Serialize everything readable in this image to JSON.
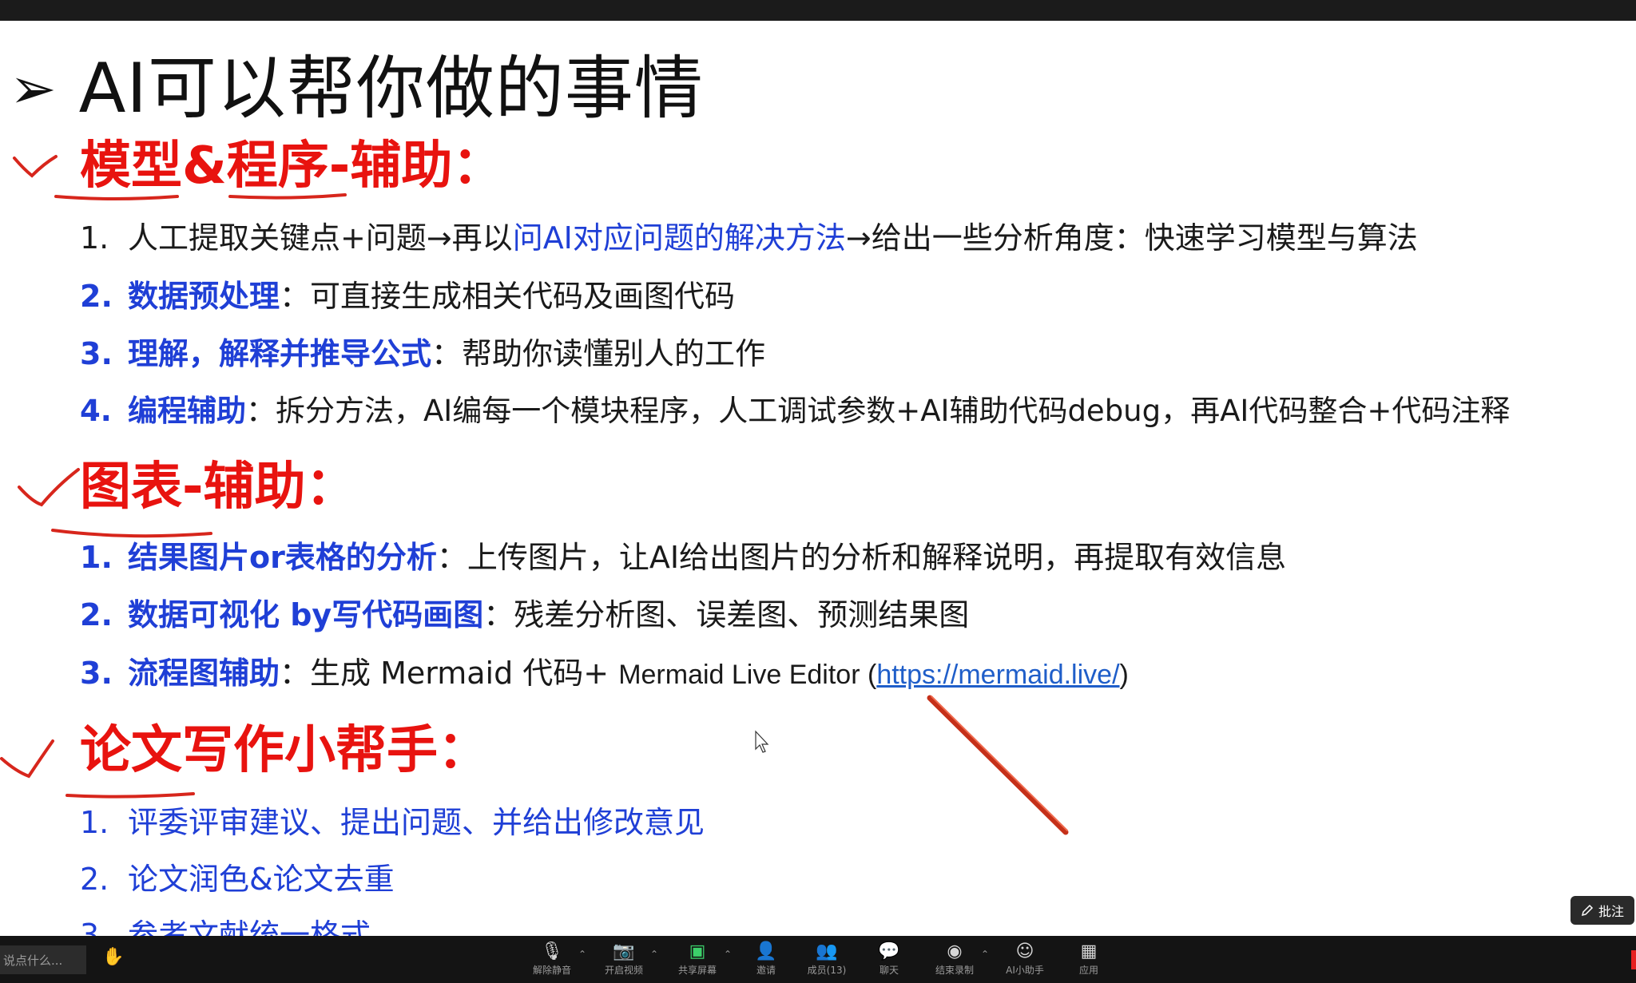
{
  "slide": {
    "title_arrow": "➢",
    "title": "AI可以帮你做的事情",
    "sections": [
      {
        "heading": "模型&程序-辅助：",
        "items": [
          {
            "num": "1.",
            "pre": "人工提取关键点+问题→再以",
            "blue": "问AI对应问题的解决方法",
            "post": "→给出一些分析角度：快速学习模型与算法"
          },
          {
            "num": "2.",
            "key": "数据预处理",
            "rest": "：可直接生成相关代码及画图代码"
          },
          {
            "num": "3.",
            "key": "理解，解释并推导公式",
            "rest": "：帮助你读懂别人的工作"
          },
          {
            "num": "4.",
            "key": "编程辅助",
            "rest": "：拆分方法，AI编每一个模块程序，人工调试参数+AI辅助代码debug，再AI代码整合+代码注释"
          }
        ]
      },
      {
        "heading": "图表-辅助：",
        "items": [
          {
            "num": "1.",
            "key": "结果图片or表格的分析",
            "rest": "：上传图片，让AI给出图片的分析和解释说明，再提取有效信息"
          },
          {
            "num": "2.",
            "key": "数据可视化 by写代码画图",
            "rest": "：残差分析图、误差图、预测结果图"
          },
          {
            "num": "3.",
            "key": "流程图辅助",
            "rest": "：生成 Mermaid 代码+ ",
            "editor": "Mermaid Live Editor (",
            "link": "https://mermaid.live/",
            "close": ")"
          }
        ]
      },
      {
        "heading": "论文写作小帮手：",
        "items": [
          {
            "num": "1.",
            "text": "评委评审建议、提出问题、并给出修改意见"
          },
          {
            "num": "2.",
            "text": "论文润色&论文去重"
          },
          {
            "num": "3.",
            "text": "参考文献统一格式"
          }
        ]
      }
    ]
  },
  "annotate_button": {
    "label": "批注",
    "icon": "pen-icon"
  },
  "toolbar": {
    "chat_placeholder": "说点什么...",
    "buttons": [
      {
        "icon": "mic-off-icon",
        "label": "解除静音"
      },
      {
        "icon": "camera-off-icon",
        "label": "开启视频"
      },
      {
        "icon": "share-screen-icon",
        "label": "共享屏幕"
      },
      {
        "icon": "invite-icon",
        "label": "邀请"
      },
      {
        "icon": "members-icon",
        "label": "成员(13)"
      },
      {
        "icon": "chat-icon",
        "label": "聊天"
      },
      {
        "icon": "record-icon",
        "label": "结束录制"
      },
      {
        "icon": "ai-assistant-icon",
        "label": "AI小助手"
      },
      {
        "icon": "apps-icon",
        "label": "应用"
      }
    ]
  }
}
